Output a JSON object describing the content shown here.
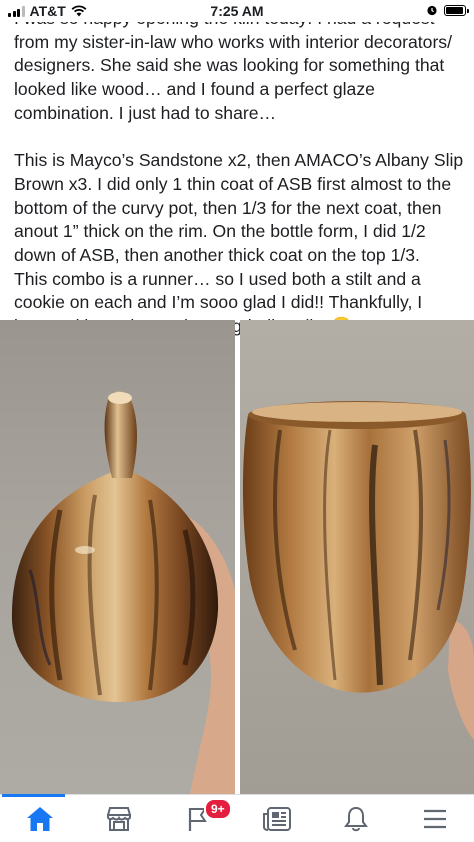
{
  "status_bar": {
    "carrier": "AT&T",
    "time": "7:25 AM",
    "battery_level": 0.95
  },
  "post": {
    "paragraph1": "I was so happy opening the kiln today! I had a request from my sister-in-law who works with interior decorators/ designers. She said she was looking for something that looked like wood… and I found a perfect glaze combination. I just had to share…",
    "paragraph2": "This is Mayco’s Sandstone x2, then AMACO’s Albany Slip Brown x3. I did only 1 thin coat of ASB first almost to the bottom of the curvy pot, then 1/3 for the next coat, then anout 1” thick on the rim. On the bottle form, I did 1/2 down of ASB, then another thick coat on the top 1/3.",
    "paragraph3": "This combo is a runner… so I used both a stilt and a cookie on each and I’m sooo glad I did!! Thankfully, I invested in a Diamond core grinding disc😏"
  },
  "tab_bar": {
    "notifications_badge": "9+",
    "active_color": "#1877f2",
    "items": [
      {
        "icon": "home-icon",
        "active": true
      },
      {
        "icon": "marketplace-icon",
        "active": false
      },
      {
        "icon": "flag-icon",
        "active": false
      },
      {
        "icon": "news-icon",
        "active": false
      },
      {
        "icon": "bell-icon",
        "active": false
      },
      {
        "icon": "menu-icon",
        "active": false
      }
    ]
  }
}
